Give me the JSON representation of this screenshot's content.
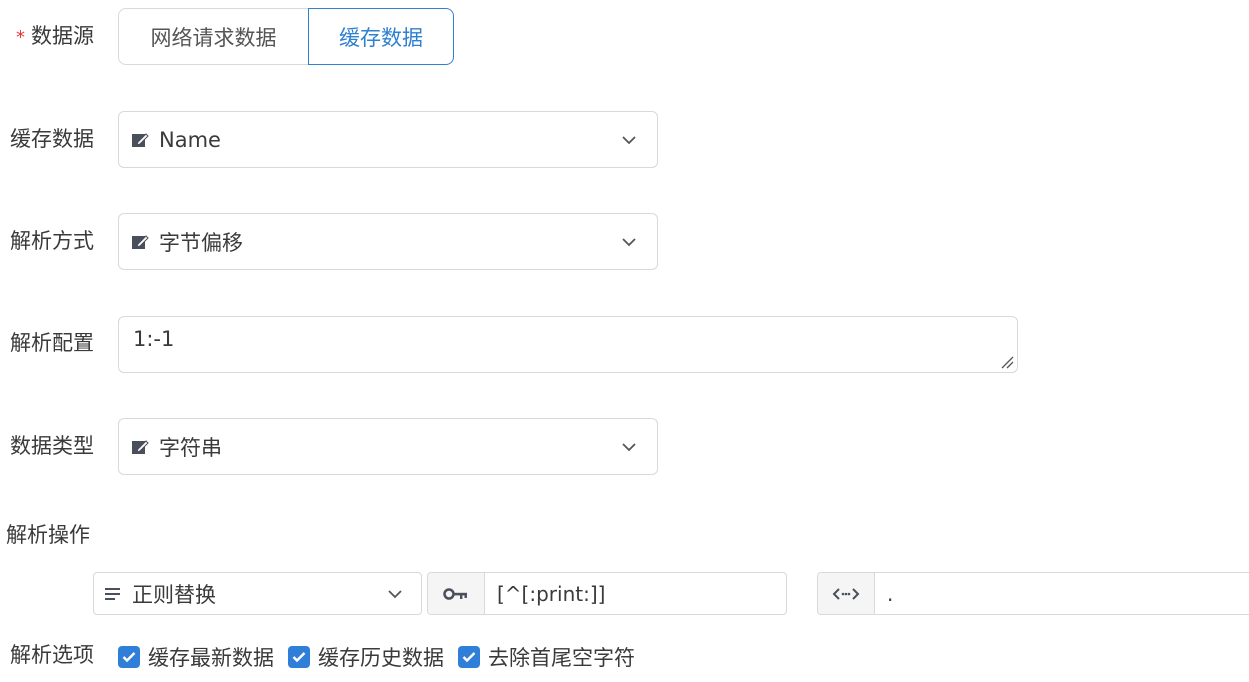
{
  "form": {
    "source": {
      "required_mark": "*",
      "label": "数据源",
      "options": [
        "网络请求数据",
        "缓存数据"
      ],
      "selected": "缓存数据"
    },
    "cache_data": {
      "label": "缓存数据",
      "value": "Name"
    },
    "parse_method": {
      "label": "解析方式",
      "value": "字节偏移"
    },
    "parse_config": {
      "label": "解析配置",
      "value": "1:-1"
    },
    "data_type": {
      "label": "数据类型",
      "value": "字符串"
    },
    "parse_action": {
      "label": "解析操作",
      "operation": "正则替换",
      "pattern": "[^[:print:]]",
      "replacement": "."
    },
    "parse_options": {
      "label": "解析选项",
      "items": [
        {
          "label": "缓存最新数据",
          "checked": true
        },
        {
          "label": "缓存历史数据",
          "checked": true
        },
        {
          "label": "去除首尾空字符",
          "checked": true
        }
      ]
    }
  },
  "colors": {
    "accent": "#2f80d1",
    "required": "#e53935",
    "checkbox": "#2f7fd8"
  }
}
